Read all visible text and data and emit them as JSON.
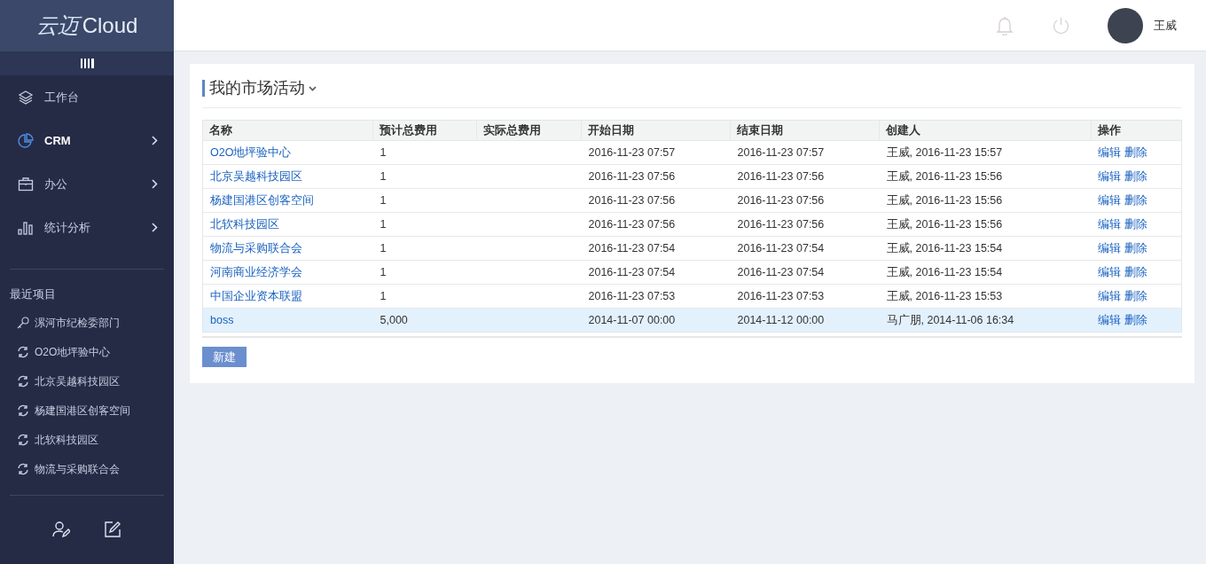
{
  "logo": {
    "mark": "云迈",
    "text": "Cloud"
  },
  "nav": [
    {
      "label": "工作台",
      "selected": false,
      "has_submenu": false
    },
    {
      "label": "CRM",
      "selected": true,
      "has_submenu": true
    },
    {
      "label": "办公",
      "selected": false,
      "has_submenu": true
    },
    {
      "label": "统计分析",
      "selected": false,
      "has_submenu": true
    }
  ],
  "recent": {
    "title": "最近项目",
    "items": [
      {
        "label": "漯河市纪检委部门",
        "kind": "key"
      },
      {
        "label": "O2O地坪验中心",
        "kind": "sync"
      },
      {
        "label": "北京吴越科技园区",
        "kind": "sync"
      },
      {
        "label": "杨建国港区创客空间",
        "kind": "sync"
      },
      {
        "label": "北软科技园区",
        "kind": "sync"
      },
      {
        "label": "物流与采购联合会",
        "kind": "sync"
      }
    ]
  },
  "header": {
    "user": "王威"
  },
  "panel": {
    "title": "我的市场活动",
    "new_button": "新建"
  },
  "table": {
    "columns": [
      "名称",
      "预计总费用",
      "实际总费用",
      "开始日期",
      "结束日期",
      "创建人",
      "操作"
    ],
    "rows": [
      {
        "name": "O2O地坪验中心",
        "budget": "1",
        "start": "2016-11-23 07:57",
        "end": "2016-11-23 07:57",
        "creator": "王威, 2016-11-23 15:57",
        "edit": "编辑",
        "delete": "删除",
        "selected": false
      },
      {
        "name": "北京吴越科技园区",
        "budget": "1",
        "start": "2016-11-23 07:56",
        "end": "2016-11-23 07:56",
        "creator": "王威, 2016-11-23 15:56",
        "edit": "编辑",
        "delete": "删除",
        "selected": false
      },
      {
        "name": "杨建国港区创客空间",
        "budget": "1",
        "start": "2016-11-23 07:56",
        "end": "2016-11-23 07:56",
        "creator": "王威, 2016-11-23 15:56",
        "edit": "编辑",
        "delete": "删除",
        "selected": false
      },
      {
        "name": "北软科技园区",
        "budget": "1",
        "start": "2016-11-23 07:56",
        "end": "2016-11-23 07:56",
        "creator": "王威, 2016-11-23 15:56",
        "edit": "编辑",
        "delete": "删除",
        "selected": false
      },
      {
        "name": "物流与采购联合会",
        "budget": "1",
        "start": "2016-11-23 07:54",
        "end": "2016-11-23 07:54",
        "creator": "王威, 2016-11-23 15:54",
        "edit": "编辑",
        "delete": "删除",
        "selected": false
      },
      {
        "name": "河南商业经济学会",
        "budget": "1",
        "start": "2016-11-23 07:54",
        "end": "2016-11-23 07:54",
        "creator": "王威, 2016-11-23 15:54",
        "edit": "编辑",
        "delete": "删除",
        "selected": false
      },
      {
        "name": "中国企业资本联盟",
        "budget": "1",
        "start": "2016-11-23 07:53",
        "end": "2016-11-23 07:53",
        "creator": "王威, 2016-11-23 15:53",
        "edit": "编辑",
        "delete": "删除",
        "selected": false
      },
      {
        "name": "boss",
        "budget": "5,000",
        "start": "2014-11-07 00:00",
        "end": "2014-11-12 00:00",
        "creator": "马广朋, 2014-11-06 16:34",
        "edit": "编辑",
        "delete": "删除",
        "selected": true
      }
    ]
  }
}
